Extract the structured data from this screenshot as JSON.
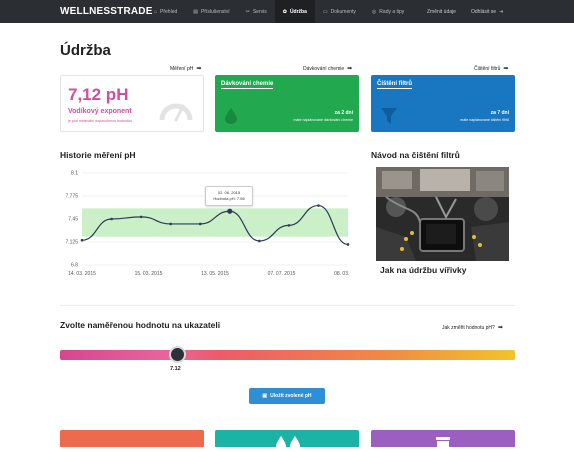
{
  "nav": {
    "brand": "WELLNESSTRADE",
    "items": [
      {
        "label": "Přehled",
        "icon": "home-icon",
        "glyph": "⌂",
        "active": false
      },
      {
        "label": "Příslušenství",
        "icon": "folder-icon",
        "glyph": "▤",
        "active": false
      },
      {
        "label": "Servis",
        "icon": "wrench-icon",
        "glyph": "✂",
        "active": false
      },
      {
        "label": "Údržba",
        "icon": "gear-icon",
        "glyph": "✿",
        "active": true
      },
      {
        "label": "Dokumenty",
        "icon": "document-icon",
        "glyph": "▭",
        "active": false
      },
      {
        "label": "Rady a tipy",
        "icon": "lightbulb-icon",
        "glyph": "◎",
        "active": false
      }
    ],
    "change_data": "Změnit údaje",
    "logout": "Odhlásit se"
  },
  "page": {
    "title": "Údržba",
    "links": {
      "measure": "Měření pH",
      "dosing": "Dávkování chemie",
      "filters": "Čištění filtrů"
    }
  },
  "cards": {
    "ph": {
      "value": "7,12 pH",
      "label": "Vodíkový exponent",
      "note": "je pod minimální doporučenou hodnotou"
    },
    "dosing": {
      "title": "Dávkování chemie",
      "due": "za 2 dní",
      "note": "máte naplánované dávkování chemie"
    },
    "filters": {
      "title": "Čištění filtrů",
      "due": "za 7 dní",
      "note": "máte naplánované čištění filtrů"
    }
  },
  "history": {
    "title": "Historie měření pH",
    "tooltip": {
      "date": "02. 06. 2015",
      "value": "Hodnota pH: 7.56"
    }
  },
  "chart_data": {
    "type": "line",
    "title": "Historie měření pH",
    "y_ticks": [
      "8.1",
      "7.775",
      "7.45",
      "7.125",
      "6.8"
    ],
    "x_ticks": [
      "14. 03. 2015",
      "15. 03. 2015",
      "13. 05. 2015",
      "07. 07. 2015",
      "08. 03. 2016"
    ],
    "ylim": [
      6.8,
      8.1
    ],
    "band": [
      7.2,
      7.6
    ],
    "series": [
      {
        "values": [
          7.15,
          7.45,
          7.48,
          7.38,
          7.38,
          7.56,
          7.14,
          7.36,
          7.64,
          7.09
        ]
      }
    ],
    "grid": true
  },
  "guide": {
    "title": "Návod na čištění filtrů",
    "caption": "Jak na údržbu vířivky"
  },
  "selector": {
    "title": "Zvolte naměřenou hodnotu na ukazateli",
    "help_link": "Jak změřit hodnotu pH?",
    "value": "7.12",
    "level_fraction": 0.26,
    "save_label": "Uložit zvolené pH"
  },
  "colors": {
    "pink": "#d14da0",
    "green": "#22a84e",
    "blue": "#1976c0",
    "orange": "#ee6a4c",
    "teal": "#1ab3a6",
    "purple": "#9b5fc0"
  }
}
